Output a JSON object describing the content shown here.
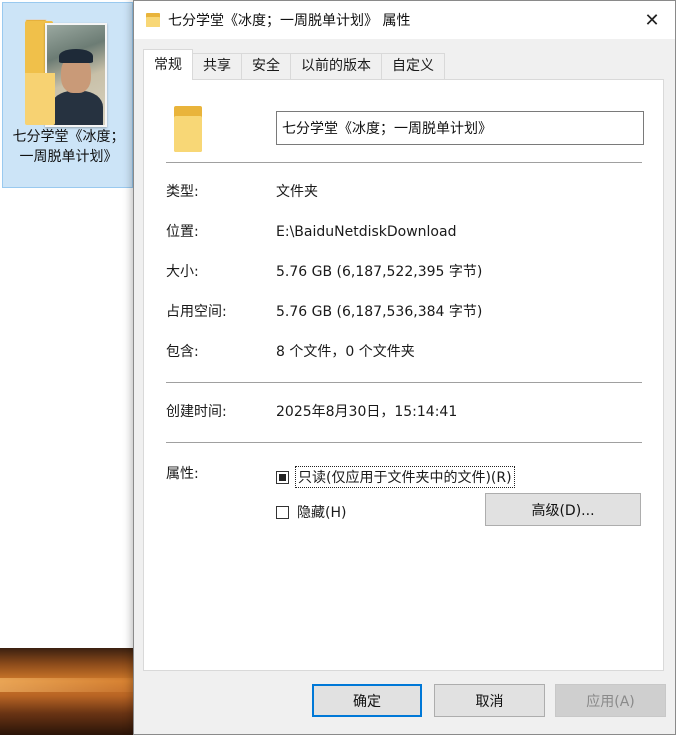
{
  "desktop": {
    "icon_label": "七分学堂《冰度；一周脱单计划》"
  },
  "dialog": {
    "title": "七分学堂《冰度；一周脱单计划》 属性",
    "close_glyph": "✕",
    "tabs": [
      {
        "label": "常规",
        "active": true
      },
      {
        "label": "共享",
        "active": false
      },
      {
        "label": "安全",
        "active": false
      },
      {
        "label": "以前的版本",
        "active": false
      },
      {
        "label": "自定义",
        "active": false
      }
    ],
    "name_value": "七分学堂《冰度；一周脱单计划》",
    "details": [
      {
        "label": "类型:",
        "value": "文件夹"
      },
      {
        "label": "位置:",
        "value": "E:\\BaiduNetdiskDownload"
      },
      {
        "label": "大小:",
        "value": "5.76 GB (6,187,522,395 字节)"
      },
      {
        "label": "占用空间:",
        "value": "5.76 GB (6,187,536,384 字节)"
      },
      {
        "label": "包含:",
        "value": "8 个文件，0 个文件夹"
      }
    ],
    "created": {
      "label": "创建时间:",
      "value": "2025年8月30日，15:14:41"
    },
    "attributes": {
      "label": "属性:",
      "readonly_label": "只读(仅应用于文件夹中的文件)(R)",
      "readonly_state": "mixed",
      "hidden_label": "隐藏(H)",
      "hidden_checked": false,
      "advanced_label": "高级(D)..."
    },
    "buttons": {
      "ok": "确定",
      "cancel": "取消",
      "apply": "应用(A)"
    }
  },
  "colors": {
    "accent": "#0078d7",
    "folder": "#f8d776",
    "selection": "#cce4f7"
  }
}
